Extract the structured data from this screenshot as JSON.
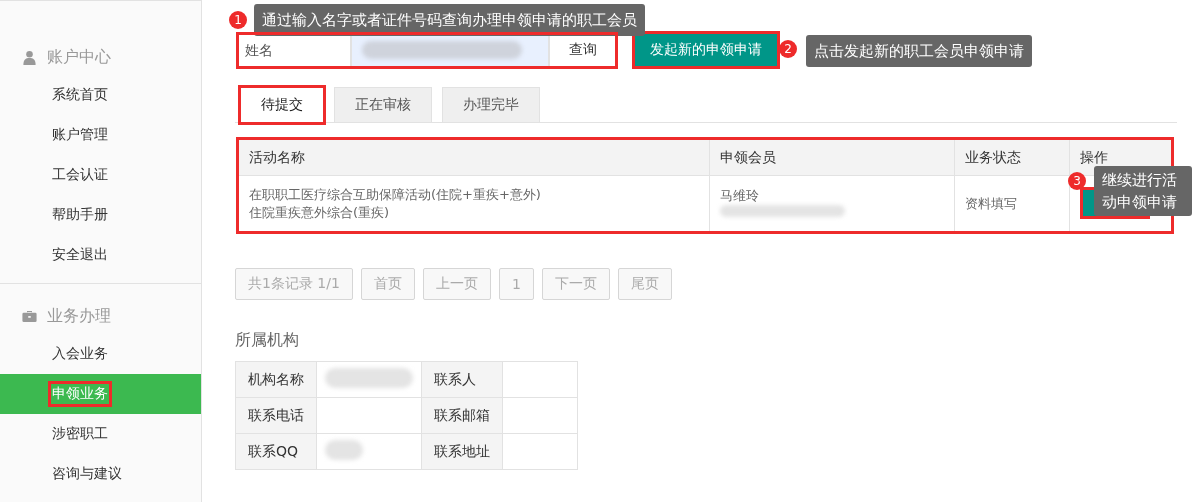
{
  "sidebar": {
    "groups": [
      {
        "title": "账户中心",
        "items": [
          {
            "label": "系统首页",
            "selected": false,
            "highlighted": false
          },
          {
            "label": "账户管理",
            "selected": false,
            "highlighted": false
          },
          {
            "label": "工会认证",
            "selected": false,
            "highlighted": false
          },
          {
            "label": "帮助手册",
            "selected": false,
            "highlighted": false
          },
          {
            "label": "安全退出",
            "selected": false,
            "highlighted": false
          }
        ]
      },
      {
        "title": "业务办理",
        "items": [
          {
            "label": "入会业务",
            "selected": false,
            "highlighted": false
          },
          {
            "label": "申领业务",
            "selected": true,
            "highlighted": true
          },
          {
            "label": "涉密职工",
            "selected": false,
            "highlighted": false
          },
          {
            "label": "咨询与建议",
            "selected": false,
            "highlighted": false
          }
        ]
      }
    ]
  },
  "search": {
    "placeholder": "姓名",
    "button": "查询",
    "highlighted": true
  },
  "new_button": {
    "label": "发起新的申领申请",
    "highlighted": true
  },
  "tabs": [
    {
      "label": "待提交",
      "selected": true,
      "highlighted": true
    },
    {
      "label": "正在审核",
      "selected": false,
      "highlighted": false
    },
    {
      "label": "办理完毕",
      "selected": false,
      "highlighted": false
    }
  ],
  "table": {
    "highlighted": true,
    "columns": [
      "活动名称",
      "申领会员",
      "业务状态",
      "操作"
    ],
    "rows": [
      {
        "activity": [
          "在职职工医疗综合互助保障活动(住院+重疾+意外)",
          "住院重疾意外综合(重疾)"
        ],
        "member": "马维玲",
        "status": "资料填写",
        "action_highlighted": true
      }
    ]
  },
  "pager": [
    "共1条记录 1/1",
    "首页",
    "上一页",
    "1",
    "下一页",
    "尾页"
  ],
  "org": {
    "title": "所属机构",
    "rows": [
      [
        {
          "label": "机构名称",
          "redacted": true
        },
        {
          "label": "联系人",
          "redacted": false
        }
      ],
      [
        {
          "label": "联系电话",
          "redacted": false
        },
        {
          "label": "联系邮箱",
          "redacted": false
        }
      ],
      [
        {
          "label": "联系QQ",
          "redacted": true
        },
        {
          "label": "联系地址",
          "redacted": false
        }
      ]
    ]
  },
  "callouts": [
    {
      "number": "1",
      "text": "通过输入名字或者证件号码查询办理申领申请的职工会员"
    },
    {
      "number": "2",
      "text": "点击发起新的职工会员申领申请"
    },
    {
      "number": "3",
      "text": "继续进行活动申领申请"
    }
  ]
}
